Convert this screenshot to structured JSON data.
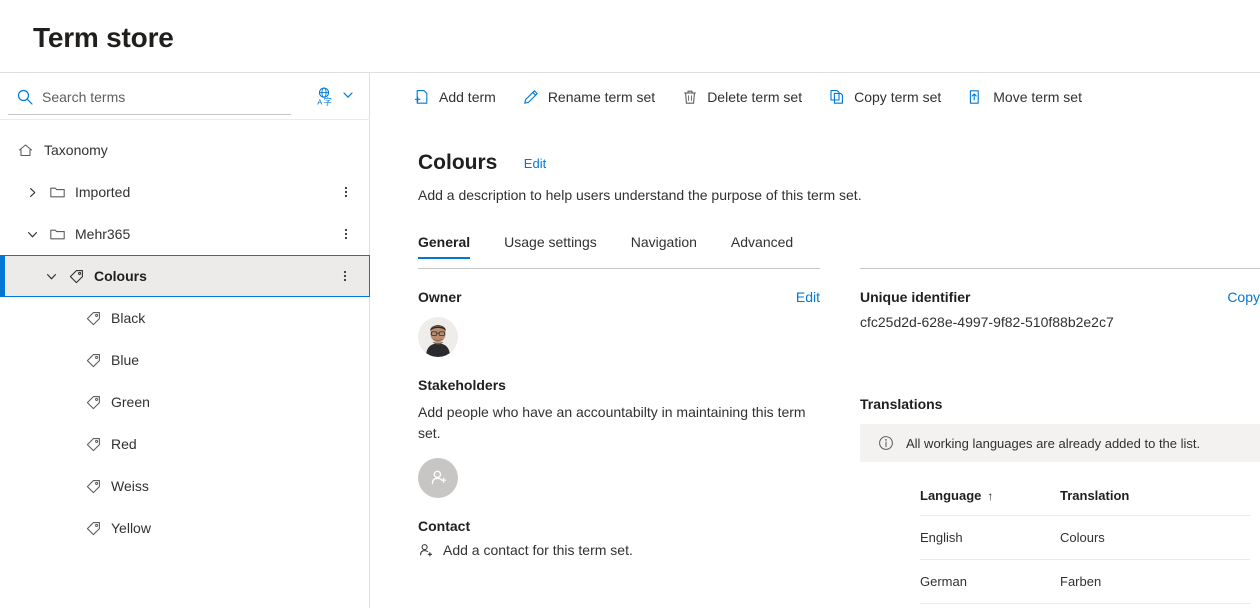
{
  "header": {
    "title": "Term store"
  },
  "search": {
    "placeholder": "Search terms",
    "value": "",
    "icon": "search-icon",
    "language_icon": "language-translate-icon",
    "chevron_icon": "chevron-down-icon"
  },
  "tree": {
    "root": {
      "label": "Taxonomy",
      "icon": "home-icon"
    },
    "items": [
      {
        "label": "Imported",
        "icon": "folder-icon",
        "chevron": "chevron-right-icon",
        "expanded": false,
        "level": 1,
        "selected": false,
        "has_menu": true
      },
      {
        "label": "Mehr365",
        "icon": "folder-icon",
        "chevron": "chevron-down-icon",
        "expanded": true,
        "level": 1,
        "selected": false,
        "has_menu": true
      },
      {
        "label": "Colours",
        "icon": "tag-icon",
        "chevron": "chevron-down-icon",
        "expanded": true,
        "level": 2,
        "selected": true,
        "has_menu": true
      },
      {
        "label": "Black",
        "icon": "tag-icon",
        "level": 3,
        "selected": false,
        "has_menu": false
      },
      {
        "label": "Blue",
        "icon": "tag-icon",
        "level": 3,
        "selected": false,
        "has_menu": false
      },
      {
        "label": "Green",
        "icon": "tag-icon",
        "level": 3,
        "selected": false,
        "has_menu": false
      },
      {
        "label": "Red",
        "icon": "tag-icon",
        "level": 3,
        "selected": false,
        "has_menu": false
      },
      {
        "label": "Weiss",
        "icon": "tag-icon",
        "level": 3,
        "selected": false,
        "has_menu": false
      },
      {
        "label": "Yellow",
        "icon": "tag-icon",
        "level": 3,
        "selected": false,
        "has_menu": false
      }
    ]
  },
  "toolbar": {
    "items": [
      {
        "label": "Add term",
        "icon": "add-page-icon"
      },
      {
        "label": "Rename term set",
        "icon": "pencil-edit-icon"
      },
      {
        "label": "Delete term set",
        "icon": "trash-icon"
      },
      {
        "label": "Copy term set",
        "icon": "copy-icon"
      },
      {
        "label": "Move term set",
        "icon": "move-icon"
      }
    ]
  },
  "termset": {
    "title": "Colours",
    "edit_label": "Edit",
    "description": "Add a description to help users understand the purpose of this term set."
  },
  "tabs": [
    {
      "label": "General",
      "active": true
    },
    {
      "label": "Usage settings",
      "active": false
    },
    {
      "label": "Navigation",
      "active": false
    },
    {
      "label": "Advanced",
      "active": false
    }
  ],
  "owner": {
    "title": "Owner",
    "edit_label": "Edit",
    "avatar": "user-photo-avatar"
  },
  "stakeholders": {
    "title": "Stakeholders",
    "description": "Add people who have an accountabilty in maintaining this term set.",
    "add_icon": "add-person-avatar-icon"
  },
  "contact": {
    "title": "Contact",
    "add_label": "Add a contact for this term set.",
    "icon": "add-person-icon"
  },
  "unique_identifier": {
    "title": "Unique identifier",
    "copy_label": "Copy",
    "value": "cfc25d2d-628e-4997-9f82-510f88b2e2c7"
  },
  "translations": {
    "title": "Translations",
    "banner": {
      "icon": "info-circle-icon",
      "text": "All working languages are already added to the list."
    },
    "columns": [
      {
        "label": "Language",
        "sorted": true,
        "sort_arrow": "↑"
      },
      {
        "label": "Translation",
        "sorted": false
      }
    ],
    "rows": [
      {
        "language": "English",
        "translation": "Colours"
      },
      {
        "language": "German",
        "translation": "Farben"
      }
    ]
  },
  "colors": {
    "accent": "#0078d4",
    "selected_row_bg": "#edebe9",
    "banner_bg": "#f3f2f1",
    "text": "#323130"
  }
}
